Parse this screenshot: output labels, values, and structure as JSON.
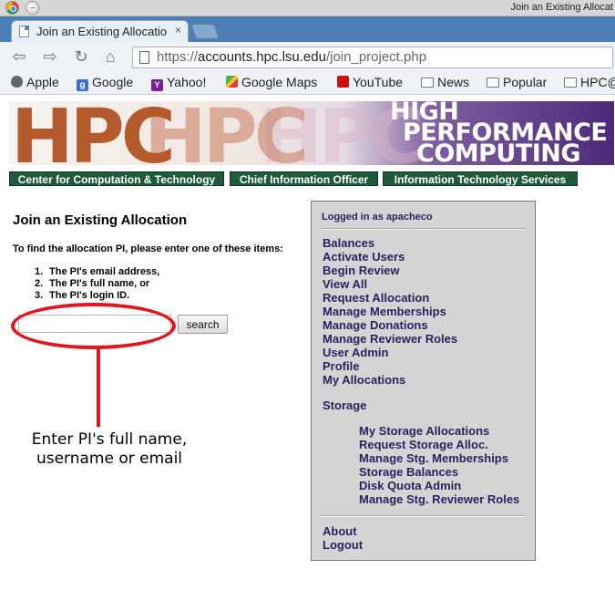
{
  "browser": {
    "window_title": "Join an Existing Allocat",
    "tab_title": "Join an Existing Allocatio",
    "tab_close": "×",
    "url_scheme": "https://",
    "url_host": "accounts.hpc.lsu.edu",
    "url_path": "/join_project.php",
    "bookmarks": [
      "Apple",
      "Google",
      "Yahoo!",
      "Google Maps",
      "YouTube",
      "News",
      "Popular",
      "HPC@"
    ]
  },
  "banner": {
    "logo_text": "HPC",
    "ghost_text": "HPC",
    "title_line1": "HIGH",
    "title_line2": "PERFORMANCE",
    "title_line3": "COMPUTING"
  },
  "nav": {
    "links": [
      "Center for Computation & Technology",
      "Chief Information Officer",
      "Information Technology Services"
    ]
  },
  "main": {
    "heading": "Join an Existing Allocation",
    "instructions": "To find the allocation PI, please enter one of these items:",
    "items": [
      {
        "num": "1.",
        "text": "The PI's email address,"
      },
      {
        "num": "2.",
        "text": "The PI's full name, or"
      },
      {
        "num": "3.",
        "text": "The PI's login ID."
      }
    ],
    "search_value": "",
    "search_button": "search",
    "annotation_line1": "Enter PI's full name,",
    "annotation_line2": "username or email"
  },
  "sidebar": {
    "logged_in": "Logged in as apacheco",
    "links": [
      "Balances",
      "Activate Users",
      "Begin Review",
      "View All",
      "Request Allocation",
      "Manage Memberships",
      "Manage Donations",
      "Manage Reviewer Roles",
      "User Admin",
      "Profile",
      "My Allocations"
    ],
    "storage_heading": "Storage",
    "storage_links": [
      "My Storage Allocations",
      "Request Storage Alloc.",
      "Manage Stg. Memberships",
      "Storage Balances",
      "Disk Quota Admin",
      "Manage Stg. Reviewer Roles"
    ],
    "footer_links": [
      "About",
      "Logout"
    ]
  },
  "colors": {
    "annotation_red": "#e0161c",
    "nav_green": "#1f5a3a",
    "link_purple": "#2e2060",
    "hpc_orange": "#b55a2d",
    "tab_blue": "#4b7fb5"
  }
}
